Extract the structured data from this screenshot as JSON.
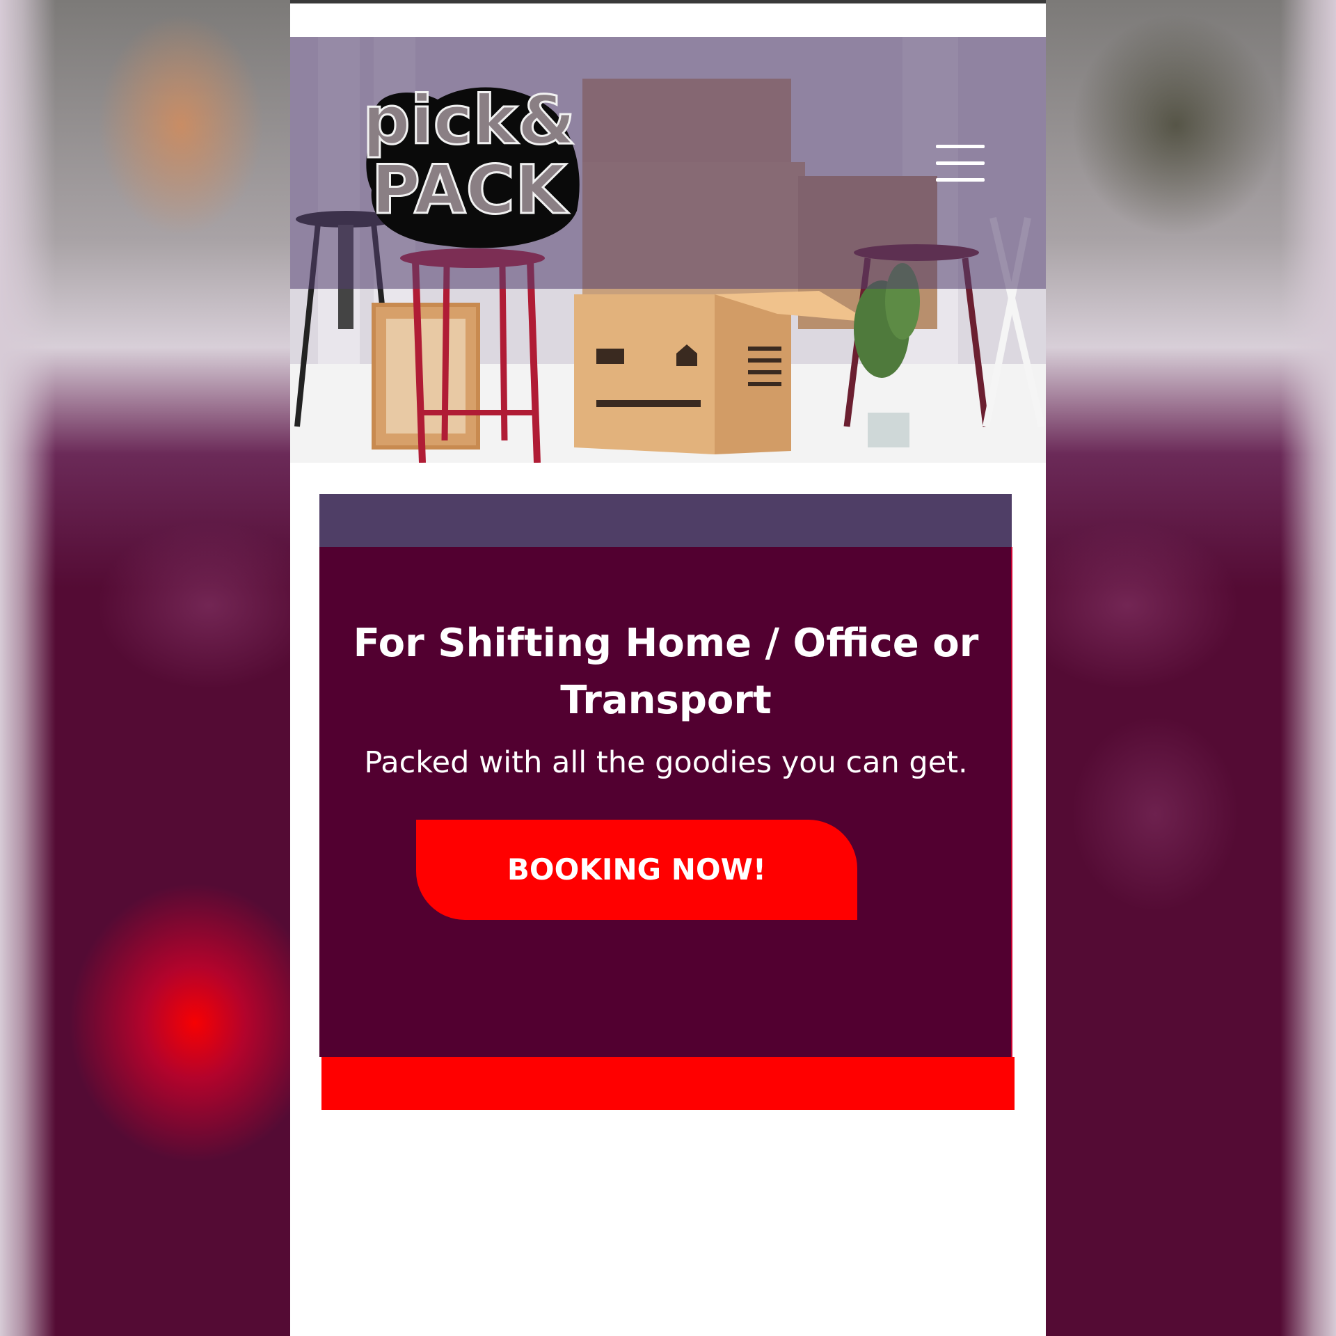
{
  "header": {
    "logo_alt": "pick & PACK",
    "logo_line1": "pick&",
    "logo_line2": "PACK",
    "menu_icon": "hamburger-menu-icon"
  },
  "hero": {
    "image_description_icon": "moving-boxes-photo"
  },
  "card": {
    "title": "For Shifting Home / Office or Transport",
    "subtitle": "Packed with all the goodies you can get.",
    "cta_label": "BOOKING NOW!"
  },
  "colors": {
    "card_background": "#520030",
    "card_top_band": "#4f3e66",
    "accent_red": "#ff0000",
    "hero_overlay": "#523e6e"
  }
}
